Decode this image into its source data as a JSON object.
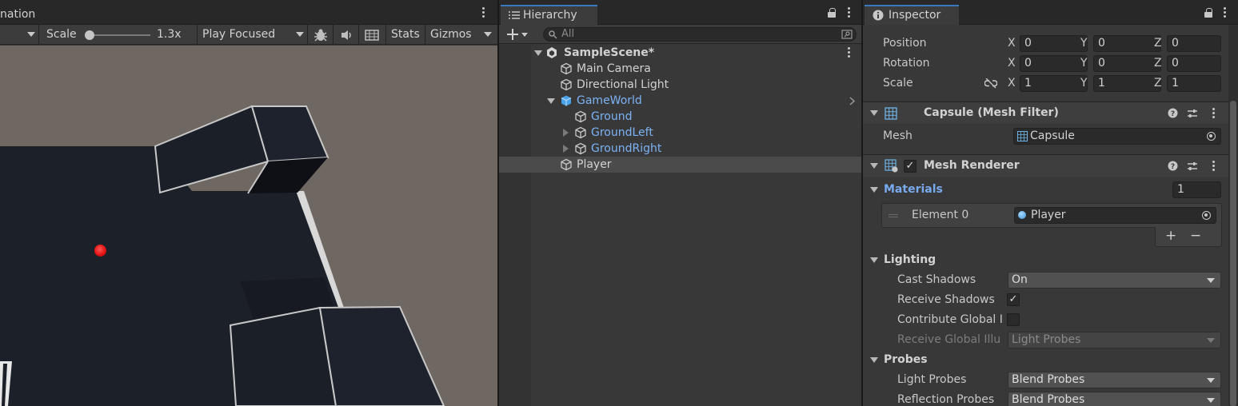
{
  "game": {
    "tab_label": "nation",
    "scale_label": "Scale",
    "scale_value": "1.3x",
    "play_mode": "Play Focused",
    "stats_label": "Stats",
    "gizmos_label": "Gizmos"
  },
  "hierarchy": {
    "tab_label": "Hierarchy",
    "search_placeholder": "All",
    "items": [
      {
        "label": "SampleScene*"
      },
      {
        "label": "Main Camera"
      },
      {
        "label": "Directional Light"
      },
      {
        "label": "GameWorld"
      },
      {
        "label": "Ground"
      },
      {
        "label": "GroundLeft"
      },
      {
        "label": "GroundRight"
      },
      {
        "label": "Player"
      }
    ]
  },
  "inspector": {
    "tab_label": "Inspector",
    "transform": {
      "position_label": "Position",
      "rotation_label": "Rotation",
      "scale_label": "Scale",
      "axes": [
        "X",
        "Y",
        "Z"
      ],
      "position": [
        "0",
        "0",
        "0"
      ],
      "rotation": [
        "0",
        "0",
        "0"
      ],
      "scale": [
        "1",
        "1",
        "1"
      ]
    },
    "mesh_filter": {
      "title": "Capsule (Mesh Filter)",
      "mesh_label": "Mesh",
      "mesh_value": "Capsule"
    },
    "mesh_renderer": {
      "title": "Mesh Renderer",
      "materials_label": "Materials",
      "materials_count": "1",
      "element_label": "Element 0",
      "element_value": "Player",
      "add_symbol": "+",
      "remove_symbol": "−"
    },
    "lighting": {
      "title": "Lighting",
      "cast_shadows_label": "Cast Shadows",
      "cast_shadows_value": "On",
      "receive_shadows_label": "Receive Shadows",
      "receive_shadows_checked": true,
      "contribute_gi_label": "Contribute Global I",
      "receive_gi_label": "Receive Global Illu",
      "receive_gi_value": "Light Probes"
    },
    "probes": {
      "title": "Probes",
      "light_probes_label": "Light Probes",
      "light_probes_value": "Blend Probes",
      "reflection_probes_label": "Reflection Probes",
      "reflection_probes_value": "Blend Probes"
    }
  },
  "colors": {
    "accent_blue": "#3a79bb",
    "prefab_blue": "#7cb3f5",
    "ground_dark": "#1b1f28",
    "sky": "#6f6761",
    "player_red": "#ff1a1a"
  }
}
